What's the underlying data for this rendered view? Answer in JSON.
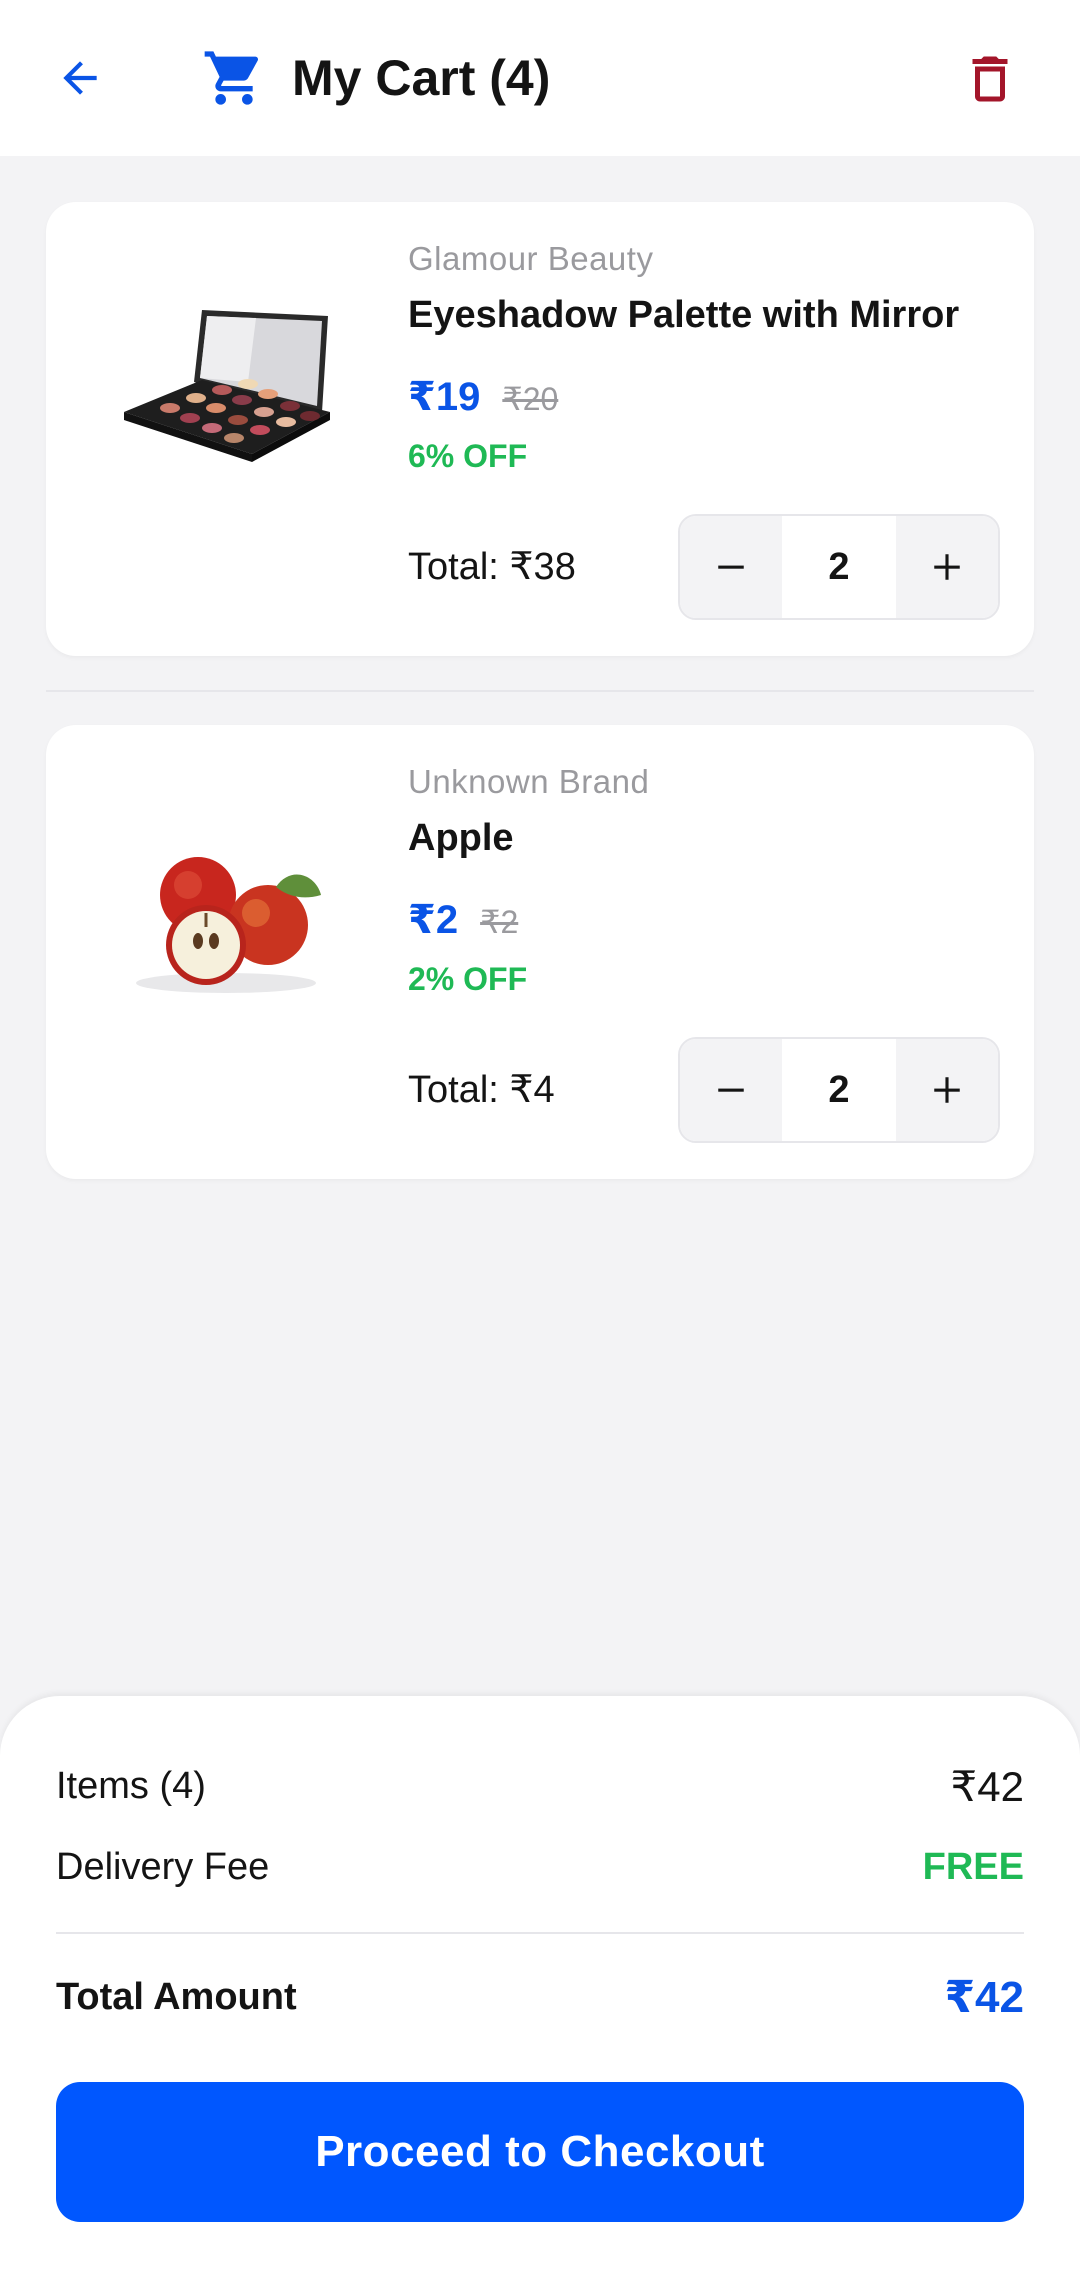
{
  "colors": {
    "accent": "#0a54e6",
    "button": "#0057ff",
    "danger": "#a3152a",
    "success": "#1fb955"
  },
  "header": {
    "back_icon": "arrow-left-icon",
    "cart_icon": "shopping-cart-icon",
    "title": "My Cart (4)",
    "trash_icon": "trash-icon"
  },
  "items": [
    {
      "brand": "Glamour Beauty",
      "name": "Eyeshadow Palette with Mirror",
      "price": "₹19",
      "mrp": "₹20",
      "discount": "6% OFF",
      "total": "Total: ₹38",
      "quantity": "2",
      "image": "eyeshadow-palette-image"
    },
    {
      "brand": "Unknown Brand",
      "name": "Apple",
      "price": "₹2",
      "mrp": "₹2",
      "discount": "2% OFF",
      "total": "Total: ₹4",
      "quantity": "2",
      "image": "apple-image"
    }
  ],
  "summary": {
    "items_label": "Items (4)",
    "items_value": "₹42",
    "delivery_label": "Delivery Fee",
    "delivery_value": "FREE",
    "total_label": "Total Amount",
    "total_value": "₹42",
    "checkout_label": "Proceed to Checkout"
  }
}
